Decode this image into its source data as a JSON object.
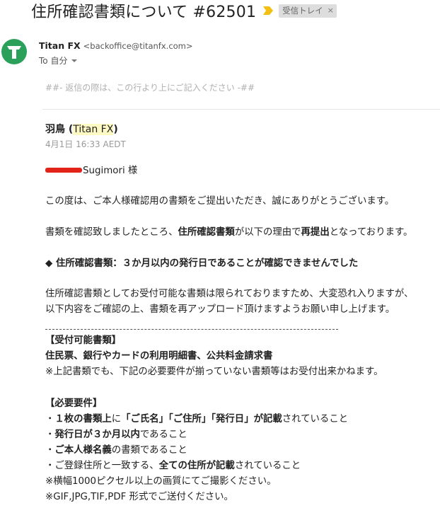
{
  "header": {
    "subject": "住所確認書類について #62501",
    "label": "受信トレイ",
    "label_close": "×"
  },
  "sender": {
    "name": "Titan FX",
    "email": "<backoffice@titanfx.com>",
    "to": "To 自分"
  },
  "reply_marker": "##- 返信の際は、この行より上にご記入ください -##",
  "comment": {
    "author": "羽鳥",
    "author_org_open": "(",
    "author_org": "Titan FX",
    "author_org_close": ")",
    "timestamp": "4月1日 16:33 AEDT"
  },
  "body": {
    "greeting_name": "Sugimori 様",
    "p1": "この度は、ご本人様確認用の書類をご提出いただき、誠にありがとうございます。",
    "p2_a": "書類を確認致しましたところ、",
    "p2_b": "住所確認書類",
    "p2_c": "が以下の理由で",
    "p2_d": "再提出",
    "p2_e": "となっております。",
    "reason": "◆ 住所確認書類：３か月以内の発行日であることが確認できませんでした",
    "p3_1": "住所確認書類としてお受付可能な書類は限られておりますため、大変恐れ入りますが、",
    "p3_2": "以下内容をご確認の上、書類を再アップロード頂けますようお願い申し上げます。",
    "accepted_heading": "【受付可能書類】",
    "accepted_docs": "住民票、銀行やカードの利用明細書、公共料金請求書",
    "accepted_note": "※上記書類でも、下記の必要要件が揃っていない書類等はお受付出来かねます。",
    "req_heading": "【必要要件】",
    "req1_a": "・",
    "req1_b": "１枚の書類上",
    "req1_c": "に",
    "req1_d": "「ご氏名」「ご住所」「発行日」が記載",
    "req1_e": "されていること",
    "req2_a": "・",
    "req2_b": "発行日が３か月以内",
    "req2_c": "であること",
    "req3_a": "・",
    "req3_b": "ご本人様名義",
    "req3_c": "の書類であること",
    "req4_a": "・ご登録住所と一致する、",
    "req4_b": "全ての住所が記載",
    "req4_c": "されていること",
    "note1": "※横幅1000ピクセル以上の画質にてご撮影ください。",
    "note2": "※GIF,JPG,TIF,PDF 形式でご送付ください。"
  },
  "colors": {
    "brand_green": "#2aa05a",
    "important_yellow": "#f2c012",
    "redaction_red": "#e2231a",
    "org_highlight": "#fff9c4"
  },
  "icons": {
    "avatar": "titan-logo-icon",
    "important": "important-marker-icon",
    "recipient_caret": "chevron-down-icon"
  }
}
